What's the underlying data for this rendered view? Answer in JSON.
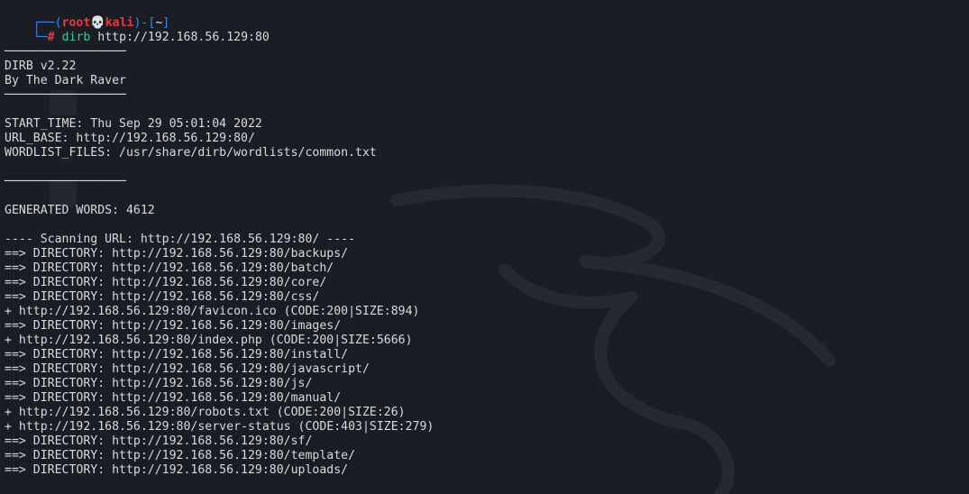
{
  "prompt": {
    "open": "┌──(",
    "user": "root",
    "skull": "💀",
    "host": "kali",
    "mid": ")-[",
    "dir": "~",
    "close": "]",
    "corner": "└─",
    "symbol": "#",
    "command": "dirb",
    "argument": "http://192.168.56.129:80"
  },
  "lines": [
    {
      "kind": "blank"
    },
    {
      "kind": "text",
      "text": "─────────────────"
    },
    {
      "kind": "text",
      "text": "DIRB v2.22"
    },
    {
      "kind": "text",
      "text": "By The Dark Raver"
    },
    {
      "kind": "text",
      "text": "─────────────────"
    },
    {
      "kind": "blank"
    },
    {
      "kind": "text",
      "text": "START_TIME: Thu Sep 29 05:01:04 2022"
    },
    {
      "kind": "text",
      "text": "URL_BASE: http://192.168.56.129:80/"
    },
    {
      "kind": "text",
      "text": "WORDLIST_FILES: /usr/share/dirb/wordlists/common.txt"
    },
    {
      "kind": "blank"
    },
    {
      "kind": "text",
      "text": "─────────────────"
    },
    {
      "kind": "blank"
    },
    {
      "kind": "text",
      "text": "GENERATED WORDS: 4612"
    },
    {
      "kind": "blank"
    },
    {
      "kind": "text",
      "text": "---- Scanning URL: http://192.168.56.129:80/ ----"
    },
    {
      "kind": "text",
      "text": "==> DIRECTORY: http://192.168.56.129:80/backups/"
    },
    {
      "kind": "text",
      "text": "==> DIRECTORY: http://192.168.56.129:80/batch/"
    },
    {
      "kind": "text",
      "text": "==> DIRECTORY: http://192.168.56.129:80/core/"
    },
    {
      "kind": "text",
      "text": "==> DIRECTORY: http://192.168.56.129:80/css/"
    },
    {
      "kind": "text",
      "text": "+ http://192.168.56.129:80/favicon.ico (CODE:200|SIZE:894)"
    },
    {
      "kind": "text",
      "text": "==> DIRECTORY: http://192.168.56.129:80/images/"
    },
    {
      "kind": "text",
      "text": "+ http://192.168.56.129:80/index.php (CODE:200|SIZE:5666)"
    },
    {
      "kind": "text",
      "text": "==> DIRECTORY: http://192.168.56.129:80/install/"
    },
    {
      "kind": "text",
      "text": "==> DIRECTORY: http://192.168.56.129:80/javascript/"
    },
    {
      "kind": "text",
      "text": "==> DIRECTORY: http://192.168.56.129:80/js/"
    },
    {
      "kind": "text",
      "text": "==> DIRECTORY: http://192.168.56.129:80/manual/"
    },
    {
      "kind": "text",
      "text": "+ http://192.168.56.129:80/robots.txt (CODE:200|SIZE:26)"
    },
    {
      "kind": "text",
      "text": "+ http://192.168.56.129:80/server-status (CODE:403|SIZE:279)"
    },
    {
      "kind": "text",
      "text": "==> DIRECTORY: http://192.168.56.129:80/sf/"
    },
    {
      "kind": "text",
      "text": "==> DIRECTORY: http://192.168.56.129:80/template/"
    },
    {
      "kind": "text",
      "text": "==> DIRECTORY: http://192.168.56.129:80/uploads/"
    }
  ],
  "colors": {
    "background": "#1b1d24",
    "text": "#d8dade",
    "prompt_frame": "#3f84f0",
    "prompt_user": "#e53b3b",
    "command": "#42c98b"
  }
}
